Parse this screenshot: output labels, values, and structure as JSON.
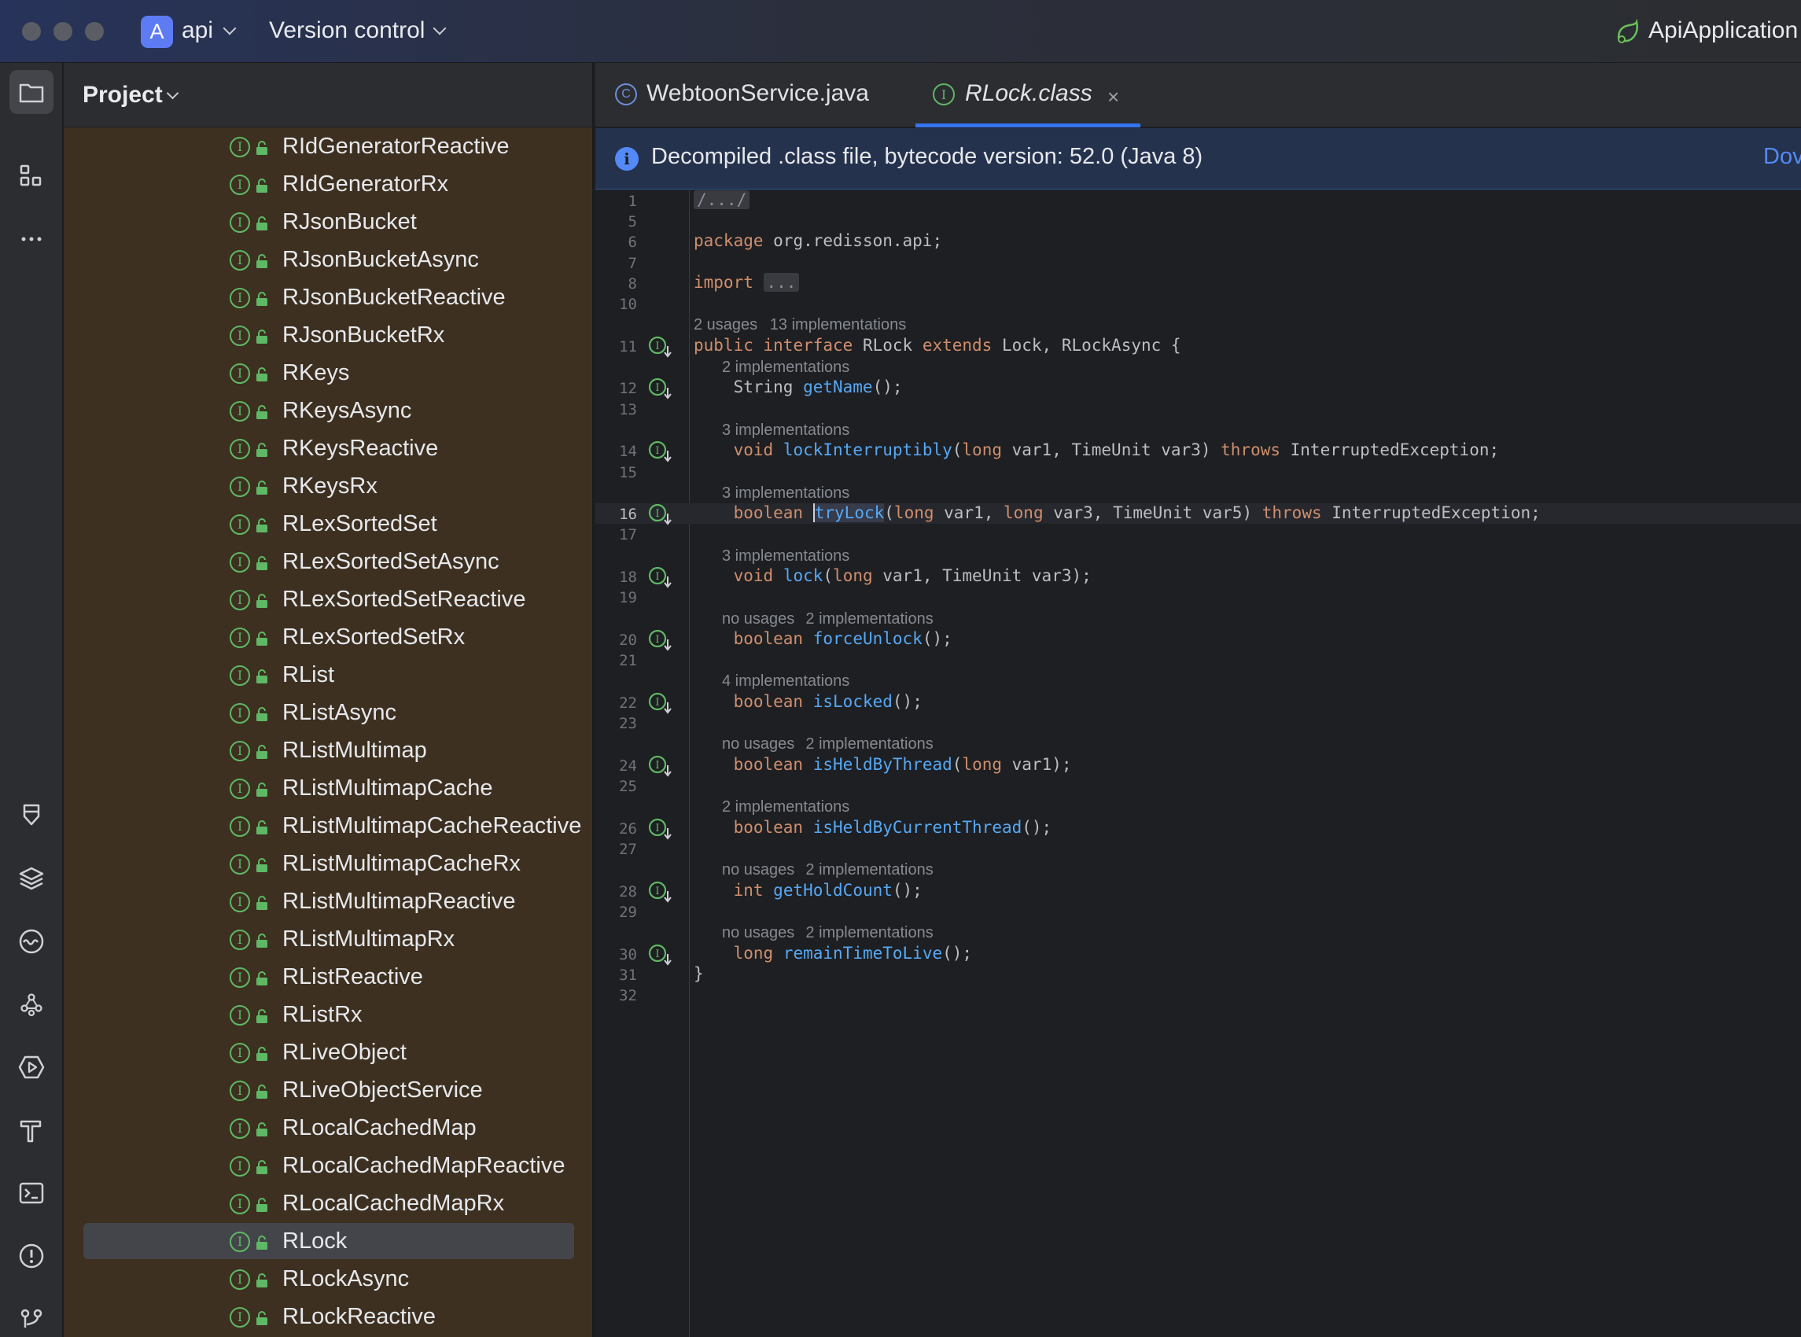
{
  "window": {
    "project_badge": "A",
    "project_name": "api",
    "vcs_label": "Version control",
    "run_config": "ApiApplication"
  },
  "project_panel": {
    "title": "Project",
    "items": [
      {
        "label": "RIdGeneratorReactive",
        "selected": false
      },
      {
        "label": "RIdGeneratorRx",
        "selected": false
      },
      {
        "label": "RJsonBucket",
        "selected": false
      },
      {
        "label": "RJsonBucketAsync",
        "selected": false
      },
      {
        "label": "RJsonBucketReactive",
        "selected": false
      },
      {
        "label": "RJsonBucketRx",
        "selected": false
      },
      {
        "label": "RKeys",
        "selected": false
      },
      {
        "label": "RKeysAsync",
        "selected": false
      },
      {
        "label": "RKeysReactive",
        "selected": false
      },
      {
        "label": "RKeysRx",
        "selected": false
      },
      {
        "label": "RLexSortedSet",
        "selected": false
      },
      {
        "label": "RLexSortedSetAsync",
        "selected": false
      },
      {
        "label": "RLexSortedSetReactive",
        "selected": false
      },
      {
        "label": "RLexSortedSetRx",
        "selected": false
      },
      {
        "label": "RList",
        "selected": false
      },
      {
        "label": "RListAsync",
        "selected": false
      },
      {
        "label": "RListMultimap",
        "selected": false
      },
      {
        "label": "RListMultimapCache",
        "selected": false
      },
      {
        "label": "RListMultimapCacheReactive",
        "selected": false
      },
      {
        "label": "RListMultimapCacheRx",
        "selected": false
      },
      {
        "label": "RListMultimapReactive",
        "selected": false
      },
      {
        "label": "RListMultimapRx",
        "selected": false
      },
      {
        "label": "RListReactive",
        "selected": false
      },
      {
        "label": "RListRx",
        "selected": false
      },
      {
        "label": "RLiveObject",
        "selected": false
      },
      {
        "label": "RLiveObjectService",
        "selected": false
      },
      {
        "label": "RLocalCachedMap",
        "selected": false
      },
      {
        "label": "RLocalCachedMapReactive",
        "selected": false
      },
      {
        "label": "RLocalCachedMapRx",
        "selected": false
      },
      {
        "label": "RLock",
        "selected": true
      },
      {
        "label": "RLockAsync",
        "selected": false
      },
      {
        "label": "RLockReactive",
        "selected": false
      }
    ]
  },
  "tabs": [
    {
      "label": "WebtoonService.java",
      "icon": "class-icon",
      "active": false
    },
    {
      "label": "RLock.class",
      "icon": "interface-icon",
      "active": true,
      "close": "×"
    }
  ],
  "banner": {
    "text": "Decompiled .class file, bytecode version: 52.0 (Java 8)",
    "link": "Dov"
  },
  "code_lines": [
    {
      "n": "1",
      "tokens": [
        {
          "t": "/.../",
          "c": "fold"
        }
      ]
    },
    {
      "n": "5",
      "tokens": []
    },
    {
      "n": "6",
      "tokens": [
        {
          "t": "package",
          "c": "kw"
        },
        {
          "t": " org.redisson.api;"
        }
      ]
    },
    {
      "n": "7",
      "tokens": []
    },
    {
      "n": "8",
      "tokens": [
        {
          "t": "import",
          "c": "kw"
        },
        {
          "t": " "
        },
        {
          "t": "...",
          "c": "fold"
        }
      ]
    },
    {
      "n": "10",
      "tokens": []
    },
    {
      "hint": [
        "2 usages",
        "13 implementations"
      ],
      "indent": 0
    },
    {
      "n": "11",
      "gutter": true,
      "tokens": [
        {
          "t": "public",
          "c": "kw"
        },
        {
          "t": " "
        },
        {
          "t": "interface",
          "c": "kw"
        },
        {
          "t": " RLock "
        },
        {
          "t": "extends",
          "c": "kw"
        },
        {
          "t": " Lock, RLockAsync {"
        }
      ]
    },
    {
      "hint": [
        "2 implementations"
      ],
      "indent": 1
    },
    {
      "n": "12",
      "gutter": true,
      "tokens": [
        {
          "t": "    String "
        },
        {
          "t": "getName",
          "c": "fn"
        },
        {
          "t": "();"
        }
      ]
    },
    {
      "n": "13",
      "tokens": []
    },
    {
      "hint": [
        "3 implementations"
      ],
      "indent": 1
    },
    {
      "n": "14",
      "gutter": true,
      "tokens": [
        {
          "t": "    "
        },
        {
          "t": "void",
          "c": "kw"
        },
        {
          "t": " "
        },
        {
          "t": "lockInterruptibly",
          "c": "fn"
        },
        {
          "t": "("
        },
        {
          "t": "long",
          "c": "kw"
        },
        {
          "t": " var1, TimeUnit var3) "
        },
        {
          "t": "throws",
          "c": "kw"
        },
        {
          "t": " InterruptedException;"
        }
      ]
    },
    {
      "n": "15",
      "tokens": []
    },
    {
      "hint": [
        "3 implementations"
      ],
      "indent": 1
    },
    {
      "n": "16",
      "gutter": true,
      "current": true,
      "tokens": [
        {
          "t": "    "
        },
        {
          "t": "boolean",
          "c": "kw"
        },
        {
          "t": " "
        },
        {
          "t": "tryLock",
          "c": "fn cursor hl"
        },
        {
          "t": "("
        },
        {
          "t": "long",
          "c": "kw"
        },
        {
          "t": " var1, "
        },
        {
          "t": "long",
          "c": "kw"
        },
        {
          "t": " var3, TimeUnit var5) "
        },
        {
          "t": "throws",
          "c": "kw"
        },
        {
          "t": " InterruptedException;"
        }
      ]
    },
    {
      "n": "17",
      "tokens": []
    },
    {
      "hint": [
        "3 implementations"
      ],
      "indent": 1
    },
    {
      "n": "18",
      "gutter": true,
      "tokens": [
        {
          "t": "    "
        },
        {
          "t": "void",
          "c": "kw"
        },
        {
          "t": " "
        },
        {
          "t": "lock",
          "c": "fn"
        },
        {
          "t": "("
        },
        {
          "t": "long",
          "c": "kw"
        },
        {
          "t": " var1, TimeUnit var3);"
        }
      ]
    },
    {
      "n": "19",
      "tokens": []
    },
    {
      "hint": [
        "no usages",
        "2 implementations"
      ],
      "indent": 1
    },
    {
      "n": "20",
      "gutter": true,
      "tokens": [
        {
          "t": "    "
        },
        {
          "t": "boolean",
          "c": "kw"
        },
        {
          "t": " "
        },
        {
          "t": "forceUnlock",
          "c": "fn"
        },
        {
          "t": "();"
        }
      ]
    },
    {
      "n": "21",
      "tokens": []
    },
    {
      "hint": [
        "4 implementations"
      ],
      "indent": 1
    },
    {
      "n": "22",
      "gutter": true,
      "tokens": [
        {
          "t": "    "
        },
        {
          "t": "boolean",
          "c": "kw"
        },
        {
          "t": " "
        },
        {
          "t": "isLocked",
          "c": "fn"
        },
        {
          "t": "();"
        }
      ]
    },
    {
      "n": "23",
      "tokens": []
    },
    {
      "hint": [
        "no usages",
        "2 implementations"
      ],
      "indent": 1
    },
    {
      "n": "24",
      "gutter": true,
      "tokens": [
        {
          "t": "    "
        },
        {
          "t": "boolean",
          "c": "kw"
        },
        {
          "t": " "
        },
        {
          "t": "isHeldByThread",
          "c": "fn"
        },
        {
          "t": "("
        },
        {
          "t": "long",
          "c": "kw"
        },
        {
          "t": " var1);"
        }
      ]
    },
    {
      "n": "25",
      "tokens": []
    },
    {
      "hint": [
        "2 implementations"
      ],
      "indent": 1
    },
    {
      "n": "26",
      "gutter": true,
      "tokens": [
        {
          "t": "    "
        },
        {
          "t": "boolean",
          "c": "kw"
        },
        {
          "t": " "
        },
        {
          "t": "isHeldByCurrentThread",
          "c": "fn"
        },
        {
          "t": "();"
        }
      ]
    },
    {
      "n": "27",
      "tokens": []
    },
    {
      "hint": [
        "no usages",
        "2 implementations"
      ],
      "indent": 1
    },
    {
      "n": "28",
      "gutter": true,
      "tokens": [
        {
          "t": "    "
        },
        {
          "t": "int",
          "c": "kw"
        },
        {
          "t": " "
        },
        {
          "t": "getHoldCount",
          "c": "fn"
        },
        {
          "t": "();"
        }
      ]
    },
    {
      "n": "29",
      "tokens": []
    },
    {
      "hint": [
        "no usages",
        "2 implementations"
      ],
      "indent": 1
    },
    {
      "n": "30",
      "gutter": true,
      "tokens": [
        {
          "t": "    "
        },
        {
          "t": "long",
          "c": "kw"
        },
        {
          "t": " "
        },
        {
          "t": "remainTimeToLive",
          "c": "fn"
        },
        {
          "t": "();"
        }
      ]
    },
    {
      "n": "31",
      "tokens": [
        {
          "t": "}"
        }
      ]
    },
    {
      "n": "32",
      "tokens": []
    }
  ]
}
